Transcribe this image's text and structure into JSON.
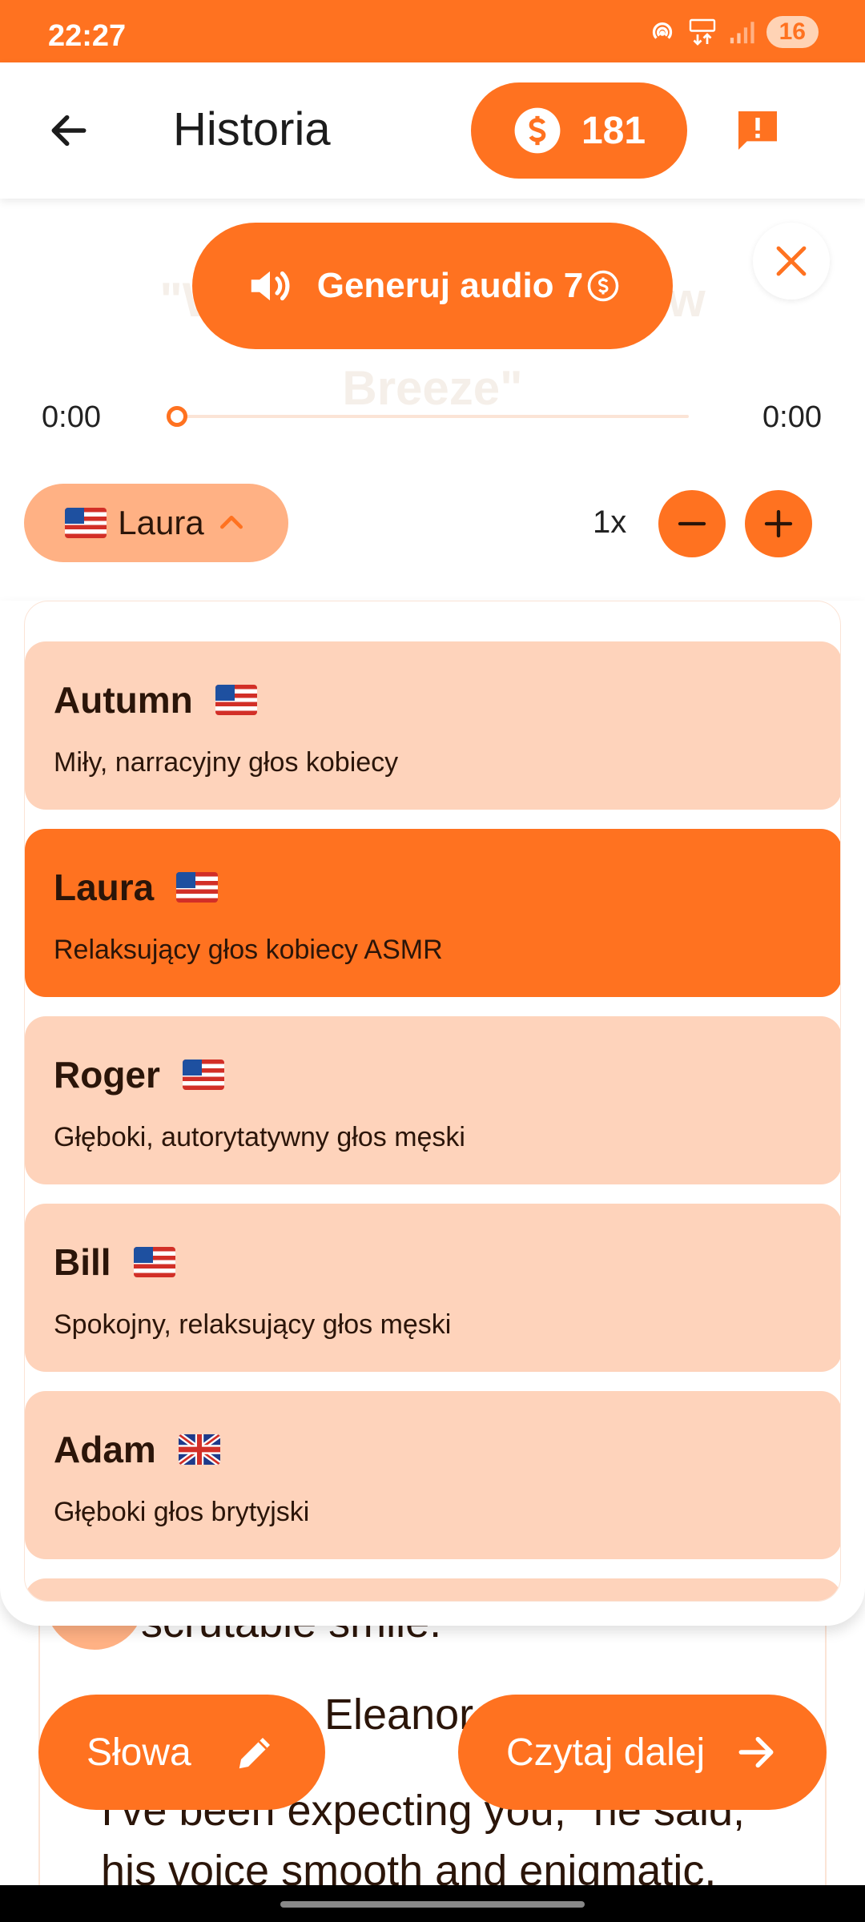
{
  "status_bar": {
    "time": "22:27",
    "battery": "16"
  },
  "app_bar": {
    "title": "Historia",
    "coins": "181"
  },
  "story_title_faded": "\"Whispers in the Willow Breeze\"",
  "player": {
    "generate_label": "Generuj audio 7",
    "time_start": "0:00",
    "time_end": "0:00",
    "progress": 0,
    "selected_voice": "Laura",
    "speed": "1x"
  },
  "voices": [
    {
      "name": "Autumn",
      "flag": "us",
      "description": "Miły, narracyjny głos kobiecy",
      "selected": false
    },
    {
      "name": "Laura",
      "flag": "us",
      "description": "Relaksujący głos kobiecy ASMR",
      "selected": true
    },
    {
      "name": "Roger",
      "flag": "us",
      "description": "Głęboki, autorytatywny głos męski",
      "selected": false
    },
    {
      "name": "Bill",
      "flag": "us",
      "description": "Spokojny, relaksujący głos męski",
      "selected": false
    },
    {
      "name": "Adam",
      "flag": "uk",
      "description": "Głęboki głos brytyjski",
      "selected": false
    }
  ],
  "story": {
    "line1": "scrutable smile.",
    "line2": "Eleanor",
    "line3": "I've been expecting you,\" he said,",
    "line4": "his voice smooth and enigmatic."
  },
  "bottom": {
    "words_label": "Słowa",
    "next_label": "Czytaj dalej"
  },
  "colors": {
    "accent": "#ff7220",
    "accent_light": "#fed3bb",
    "accent_mid": "#ffb184"
  }
}
